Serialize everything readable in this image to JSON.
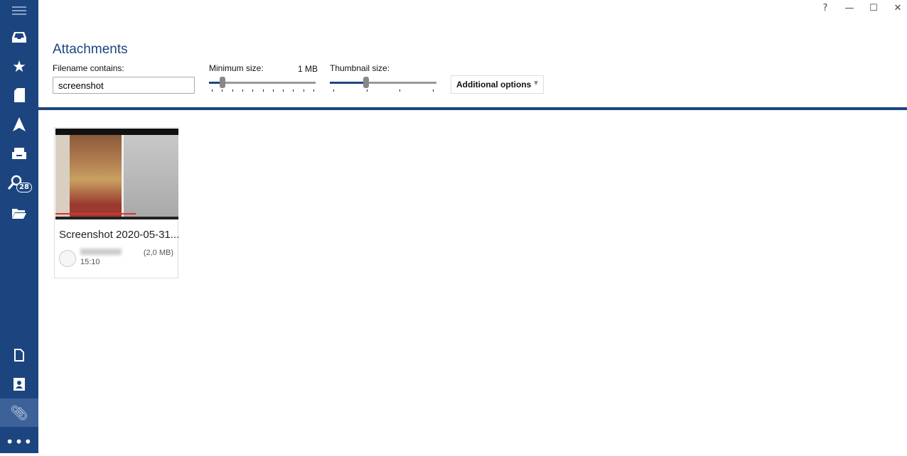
{
  "sidebar": {
    "items": [
      {
        "name": "menu-icon"
      },
      {
        "name": "inbox-icon"
      },
      {
        "name": "star-icon"
      },
      {
        "name": "notes-icon"
      },
      {
        "name": "send-icon"
      },
      {
        "name": "archive-icon"
      },
      {
        "name": "search-folders-icon",
        "badge": "28"
      },
      {
        "name": "folder-icon"
      },
      {
        "name": "document-icon"
      },
      {
        "name": "contacts-icon"
      },
      {
        "name": "attachment-icon",
        "active": true
      },
      {
        "name": "more-icon"
      }
    ]
  },
  "window": {
    "help": "?",
    "minimize": "—",
    "maximize": "☐",
    "close": "✕"
  },
  "page": {
    "title": "Attachments"
  },
  "filters": {
    "filename_label": "Filename contains:",
    "filename_value": "screenshot",
    "min_size_label": "Minimum size:",
    "min_size_value": "1 MB",
    "min_size_fraction": 0.1,
    "thumb_size_label": "Thumbnail size:",
    "thumb_size_fraction": 0.33,
    "additional_options": "Additional options"
  },
  "attachments": [
    {
      "name": "Screenshot 2020-05-31...",
      "size": "(2,0 MB)",
      "time": "15:10"
    }
  ],
  "colors": {
    "accent": "#1c4580"
  }
}
